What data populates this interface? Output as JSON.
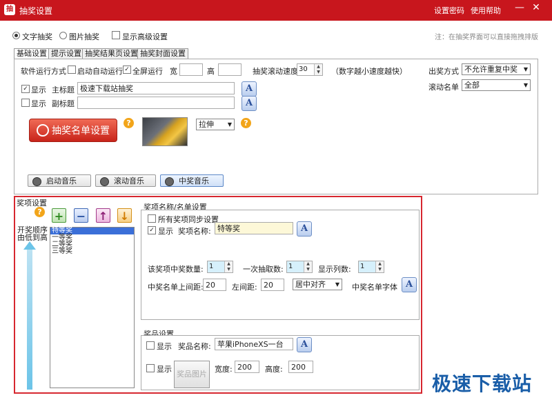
{
  "window": {
    "title": "抽奖设置",
    "menu": [
      "设置密码",
      "使用帮助"
    ],
    "min_icon": "minimize-icon",
    "close_icon": "close-icon"
  },
  "mode": {
    "text_draw": "文字抽奖",
    "image_draw": "图片抽奖",
    "show_advanced": "显示高级设置",
    "hint": "注：在抽奖界面可以直接拖拽排版"
  },
  "tabs": [
    "基础设置",
    "提示设置",
    "抽奖结果页设置",
    "抽奖封面设置"
  ],
  "basic": {
    "run_mode_label": "软件运行方式",
    "auto_start": "启动自动运行",
    "fullscreen": "全屏运行",
    "width_label": "宽",
    "height_label": "高",
    "scroll_speed_label": "抽奖滚动速度",
    "scroll_speed_value": "30",
    "scroll_speed_hint": "（数字越小速度越快）",
    "output_mode_label": "出奖方式",
    "output_mode_value": "不允许重复中奖",
    "scroll_list_label": "滚动名单",
    "scroll_list_value": "全部",
    "show_label": "显示",
    "main_title_label": "主标题",
    "main_title_value": "极速下载站抽奖",
    "sub_title_label": "副标题",
    "sub_title_value": "",
    "list_setting_button": "抽奖名单设置",
    "stretch_value": "拉伸",
    "music_start": "启动音乐",
    "music_scroll": "滚动音乐",
    "music_win": "中奖音乐"
  },
  "prize": {
    "section_title": "奖项设置",
    "order_label": "开奖顺序由低到高",
    "items": [
      "特等奖",
      "一等奖",
      "二等奖",
      "三等奖"
    ],
    "name_list_title": "奖项名称/名单设置",
    "sync_all": "所有奖项同步设置",
    "show_label": "显示",
    "prize_name_label": "奖项名称:",
    "prize_name_value": "特等奖",
    "win_count_label": "该奖项中奖数量:",
    "win_count_value": "1",
    "draw_once_label": "一次抽取数:",
    "draw_once_value": "1",
    "columns_label": "显示列数:",
    "columns_value": "1",
    "top_margin_label": "中奖名单上间距:",
    "top_margin_value": "20",
    "left_margin_label": "左间距:",
    "left_margin_value": "20",
    "align_value": "居中对齐",
    "font_label": "中奖名单字体",
    "goods_title": "奖品设置",
    "goods_name_label": "奖品名称:",
    "goods_name_value": "苹果iPhoneXS一台",
    "goods_image_button": "奖品图片",
    "width_label": "宽度:",
    "width_value": "200",
    "height_label": "高度:",
    "height_value": "200"
  },
  "watermark": "极速下载站"
}
